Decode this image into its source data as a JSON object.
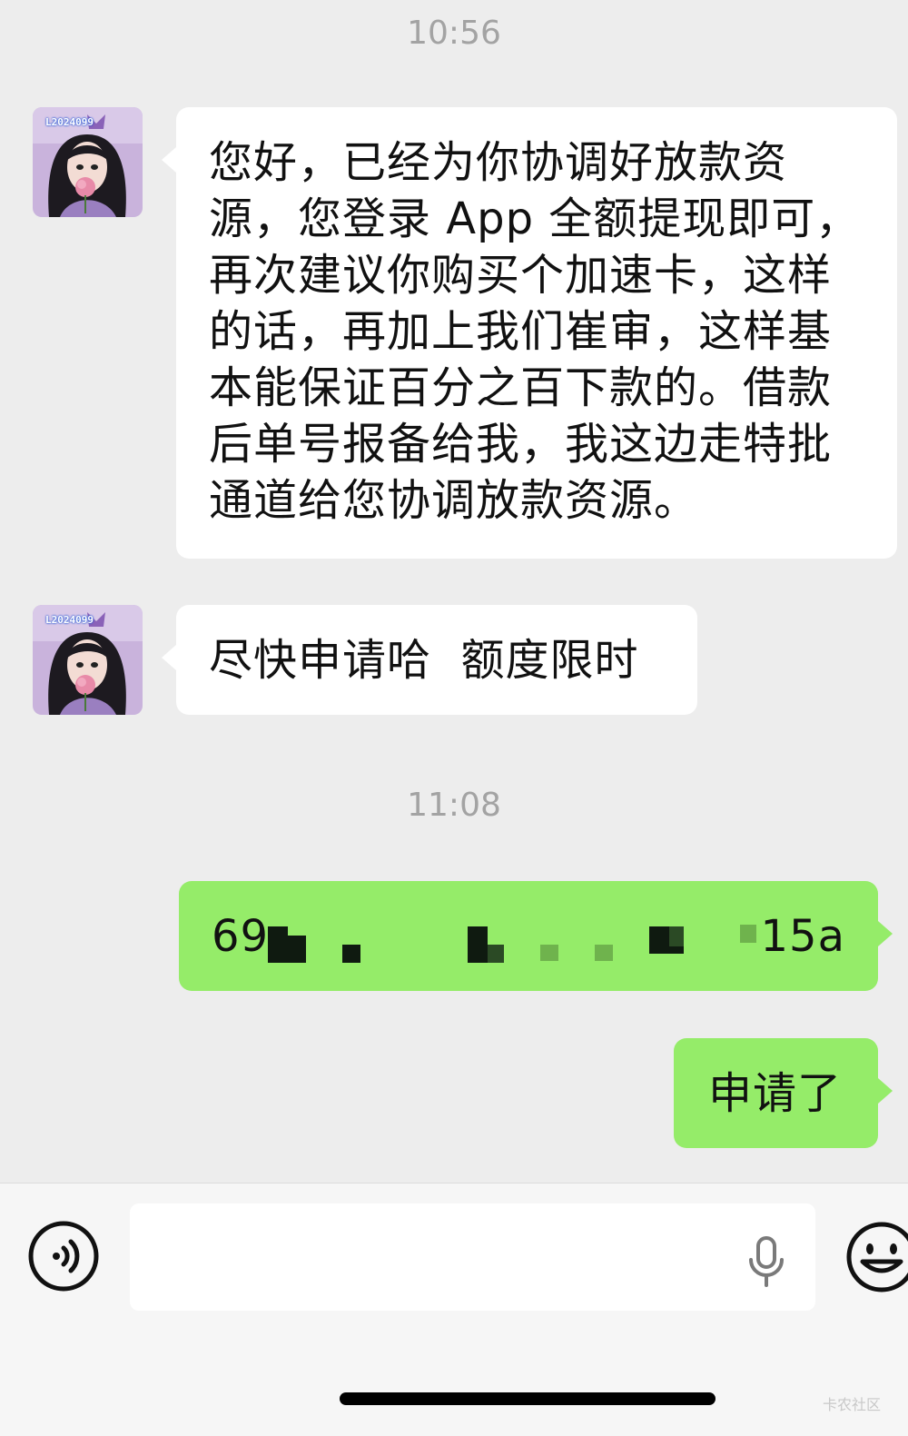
{
  "conversation": {
    "messages": [
      {
        "type": "timestamp",
        "text": "10:56"
      },
      {
        "type": "incoming",
        "avatar": "contact-avatar",
        "avatar_caption": "L2024099",
        "lines": [
          "您好，已经为你协调好放款资",
          "源，您登录 App 全额提现即可，",
          "再次建议你购买个加速卡，这样",
          "的话，再加上我们崔审，这样基",
          "本能保证百分之百下款的。借款",
          "后单号报备给我，我这边走特批",
          "通道给您协调放款资源。"
        ]
      },
      {
        "type": "incoming",
        "avatar": "contact-avatar",
        "avatar_caption": "L2024099",
        "text": "尽快申请哈  额度限时"
      },
      {
        "type": "timestamp",
        "text": "11:08"
      },
      {
        "type": "outgoing",
        "text_start": "69",
        "text_end": "15a",
        "redacted": true
      },
      {
        "type": "outgoing",
        "text": "申请了"
      }
    ]
  },
  "input_bar": {
    "voice_icon": "voice-input-icon",
    "mic_icon": "microphone-icon",
    "emoji_icon": "emoji-icon",
    "text_value": ""
  },
  "watermark": "卡农社区",
  "colors": {
    "background": "#ededed",
    "incoming_bubble": "#ffffff",
    "outgoing_bubble": "#95ec69",
    "timestamp": "#a3a3a3"
  }
}
